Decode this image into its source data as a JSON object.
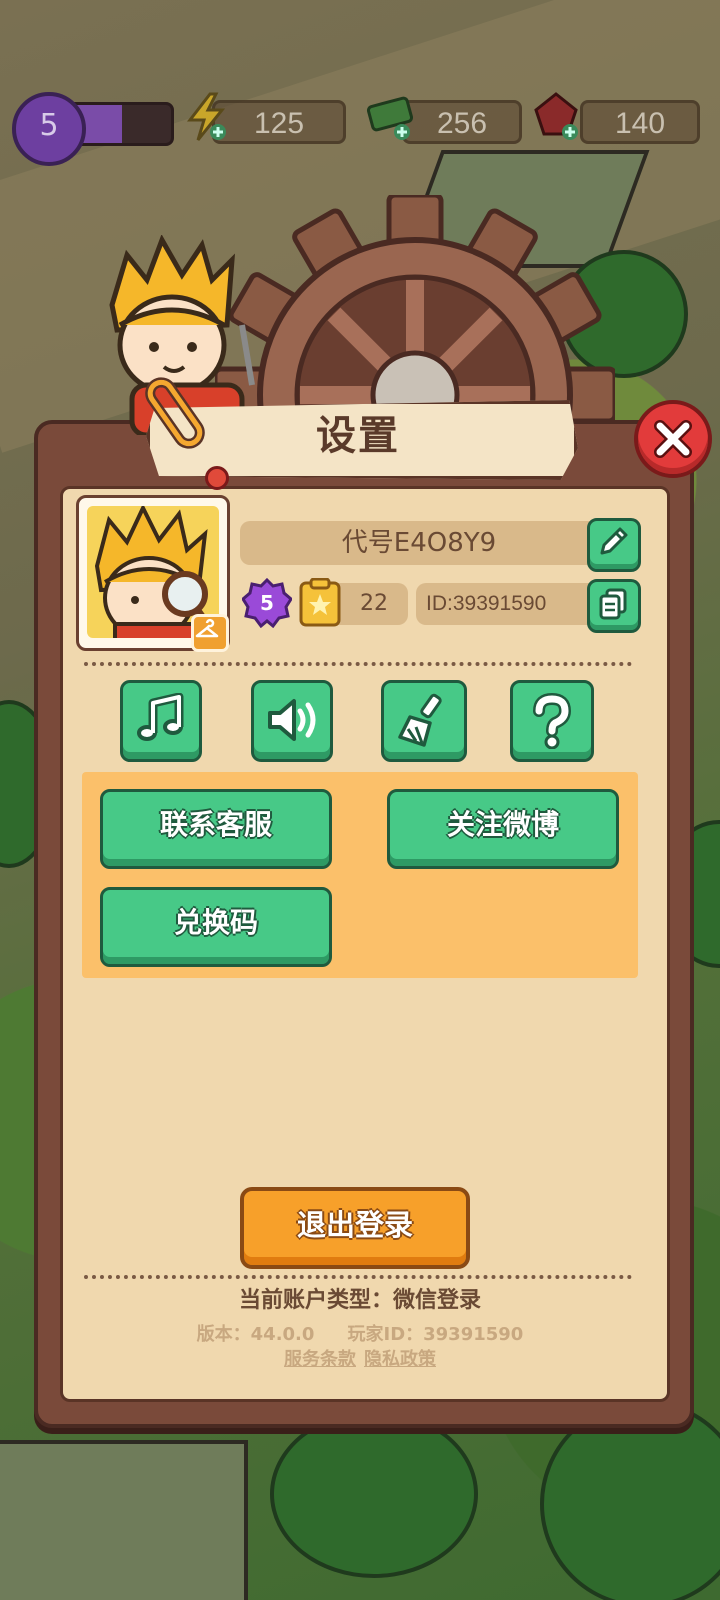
{
  "hud": {
    "level": "5",
    "level_progress": 0.55,
    "energy": "125",
    "cash": "256",
    "gems": "140"
  },
  "panel": {
    "title": "设置"
  },
  "profile": {
    "name": "代号E4O8Y9",
    "level": "5",
    "score": "22",
    "player_id": "ID:39391590"
  },
  "icons": {
    "music": "music-note-icon",
    "sound": "speaker-icon",
    "clean": "broom-icon",
    "help": "question-mark-icon",
    "edit": "pencil-icon",
    "copy": "copy-icon",
    "close": "close-icon"
  },
  "actions": {
    "customer_service": "联系客服",
    "follow_weibo": "关注微博",
    "redeem_code": "兑换码"
  },
  "footer": {
    "logout": "退出登录",
    "account_type": "当前账户类型：微信登录",
    "version": "版本：44.0.0",
    "player_id_label": "玩家ID：39391590",
    "terms": "服务条款",
    "privacy": "隐私政策"
  },
  "colors": {
    "green_button": "#47c987",
    "orange_button": "#f7a02a",
    "panel_bg": "#f0d8ae",
    "close_red": "#e23b3b"
  }
}
